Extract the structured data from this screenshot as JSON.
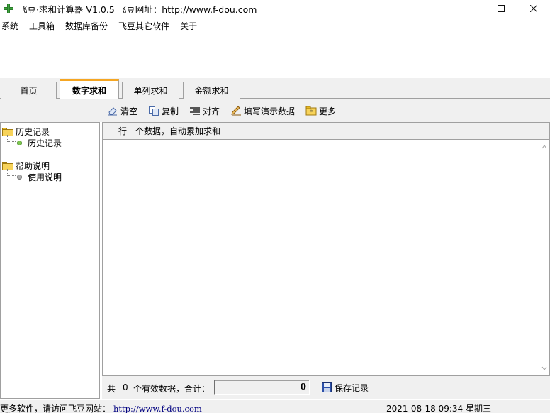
{
  "window": {
    "title": "飞豆·求和计算器 V1.0.5  飞豆网址：http://www.f-dou.com"
  },
  "menu": {
    "items": [
      {
        "label": "系统"
      },
      {
        "label": "工具箱"
      },
      {
        "label": "数据库备份"
      },
      {
        "label": "飞豆其它软件"
      },
      {
        "label": "关于"
      }
    ]
  },
  "tabs": [
    {
      "label": "首页",
      "active": false
    },
    {
      "label": "数字求和",
      "active": true
    },
    {
      "label": "单列求和",
      "active": false
    },
    {
      "label": "金额求和",
      "active": false
    }
  ],
  "toolbar": {
    "clear_label": "清空",
    "copy_label": "复制",
    "align_label": "对齐",
    "demo_label": "填写演示数据",
    "more_label": "更多"
  },
  "tree": {
    "history_folder": "历史记录",
    "history_item": "历史记录",
    "help_folder": "帮助说明",
    "help_item": "使用说明"
  },
  "main": {
    "header": "一行一个数据，自动累加求和"
  },
  "summary": {
    "prefix": "共",
    "count": "0",
    "suffix": "个有效数据，合计：",
    "total": "0",
    "save_label": "保存记录"
  },
  "status": {
    "left_text": "更多软件，请访问飞豆网站：",
    "url": "http://www.f-dou.com",
    "datetime": "2021-08-18 09:34 星期三"
  },
  "colors": {
    "accent_tab": "#f5a623",
    "panel_bg": "#f0f0f0",
    "border": "#a0a0a0"
  }
}
